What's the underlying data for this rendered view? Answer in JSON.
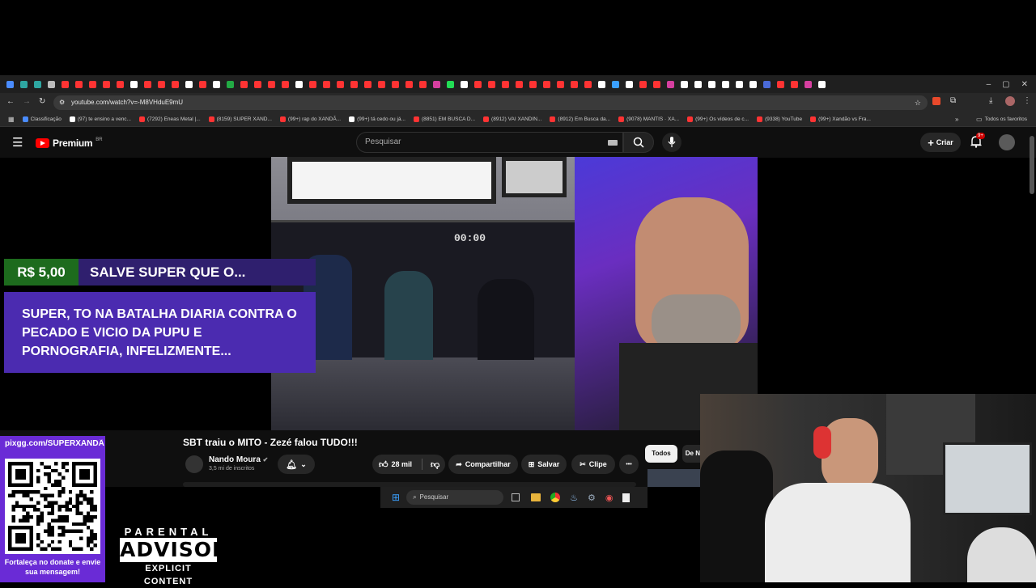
{
  "browser": {
    "url": "youtube.com/watch?v=-M8VHduE9mU",
    "bookmarks": [
      "Classificação",
      "(97) te ensino a venc...",
      "(7292) Eneas Metal |...",
      "(8159) SUPER XAND...",
      "(99+) rap do XANDÃ...",
      "(99+) tá cedo ou já...",
      "(8851) EM BUSCA D...",
      "(8912) VAI XANDIN...",
      "(8912) Em Busca da...",
      "(9078) MANTIS · XA...",
      "(99+) Os vídeos de c...",
      "(9338) YouTube",
      "(99+) Xandão vs Fra..."
    ],
    "all_bookmarks": "Todos os favoritos"
  },
  "youtube": {
    "logo": "Premium",
    "region": "BR",
    "search_placeholder": "Pesquisar",
    "create_label": "Criar",
    "notif_count": "9+"
  },
  "donation": {
    "amount": "R$ 5,00",
    "headline": "SALVE SUPER QUE O...",
    "message": "SUPER, TO NA BATALHA DIARIA CONTRA O PECADO E VICIO DA PUPU E PORNOGRAFIA, INFELIZMENTE..."
  },
  "video": {
    "title": "SBT traiu o MITO - Zezé falou TUDO!!!",
    "channel": "Nando Moura",
    "subscribers": "3,5 mi de inscritos",
    "likes": "28 mil",
    "share": "Compartilhar",
    "save": "Salvar",
    "clip": "Clipe",
    "more": "•••",
    "chip_all": "Todos",
    "chip_next": "De N",
    "timer": "00:00"
  },
  "taskbar": {
    "search_placeholder": "Pesquisar"
  },
  "pix": {
    "url": "pixgg.com/SUPERXANDÃ",
    "footer": "Fortaleça no donate e envie sua mensagem!"
  },
  "advisory": {
    "line1": "PARENTAL",
    "line2": "ADVISORY",
    "line3": "EXPLICIT CONTENT"
  },
  "colors": {
    "donation_green": "#1d6b1d",
    "donation_purple": "#4b2bb0",
    "pix_purple": "#6a2bd6",
    "youtube_red": "#ff0000"
  }
}
